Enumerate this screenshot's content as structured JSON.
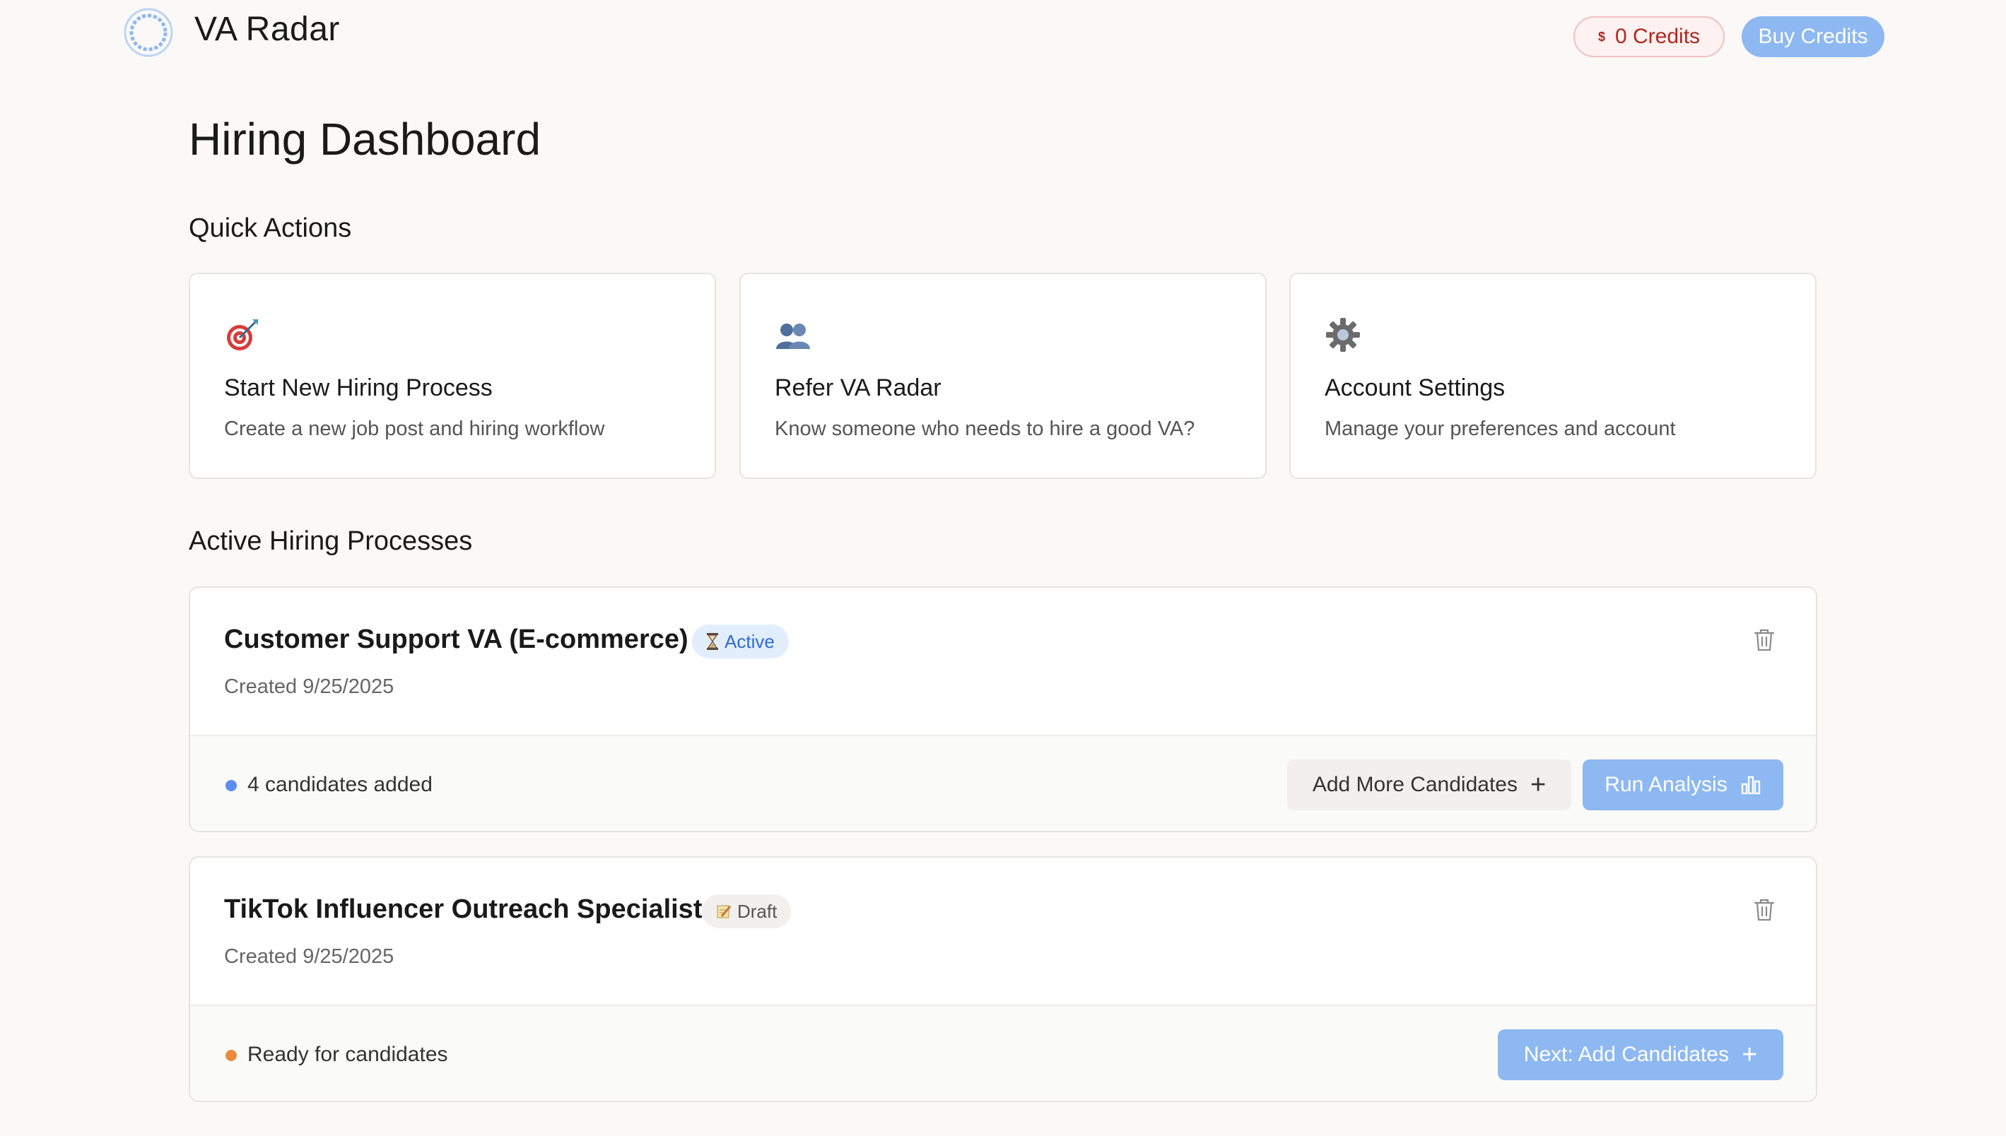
{
  "header": {
    "brand": "VA Radar",
    "credits_label": "0 Credits",
    "credits_symbol": "$",
    "buy_label": "Buy Credits"
  },
  "page_title": "Hiring Dashboard",
  "quick_actions": {
    "title": "Quick Actions",
    "items": [
      {
        "icon": "target-icon",
        "name": "Start New Hiring Process",
        "desc": "Create a new job post and hiring workflow"
      },
      {
        "icon": "people-icon",
        "name": "Refer VA Radar",
        "desc": "Know someone who needs to hire a good VA?"
      },
      {
        "icon": "gear-icon",
        "name": "Account Settings",
        "desc": "Manage your preferences and account"
      }
    ]
  },
  "active_processes": {
    "title": "Active Hiring Processes",
    "items": [
      {
        "title": "Customer Support VA (E-commerce)",
        "badge": "Active",
        "badge_icon": "hourglass-icon",
        "created": "Created 9/25/2025",
        "status": "4 candidates added",
        "status_color": "#5b8def",
        "secondary_action": "Add More Candidates",
        "primary_action": "Run Analysis"
      },
      {
        "title": "TikTok Influencer Outreach Specialist",
        "badge": "Draft",
        "badge_icon": "memo-icon",
        "created": "Created 9/25/2025",
        "status": "Ready for candidates",
        "status_color": "#ea8a3e",
        "primary_action": "Next: Add Candidates"
      }
    ]
  },
  "colors": {
    "accent": "#8db8f2",
    "credits_text": "#b3261e",
    "badge_active": "#2d6bd1"
  }
}
